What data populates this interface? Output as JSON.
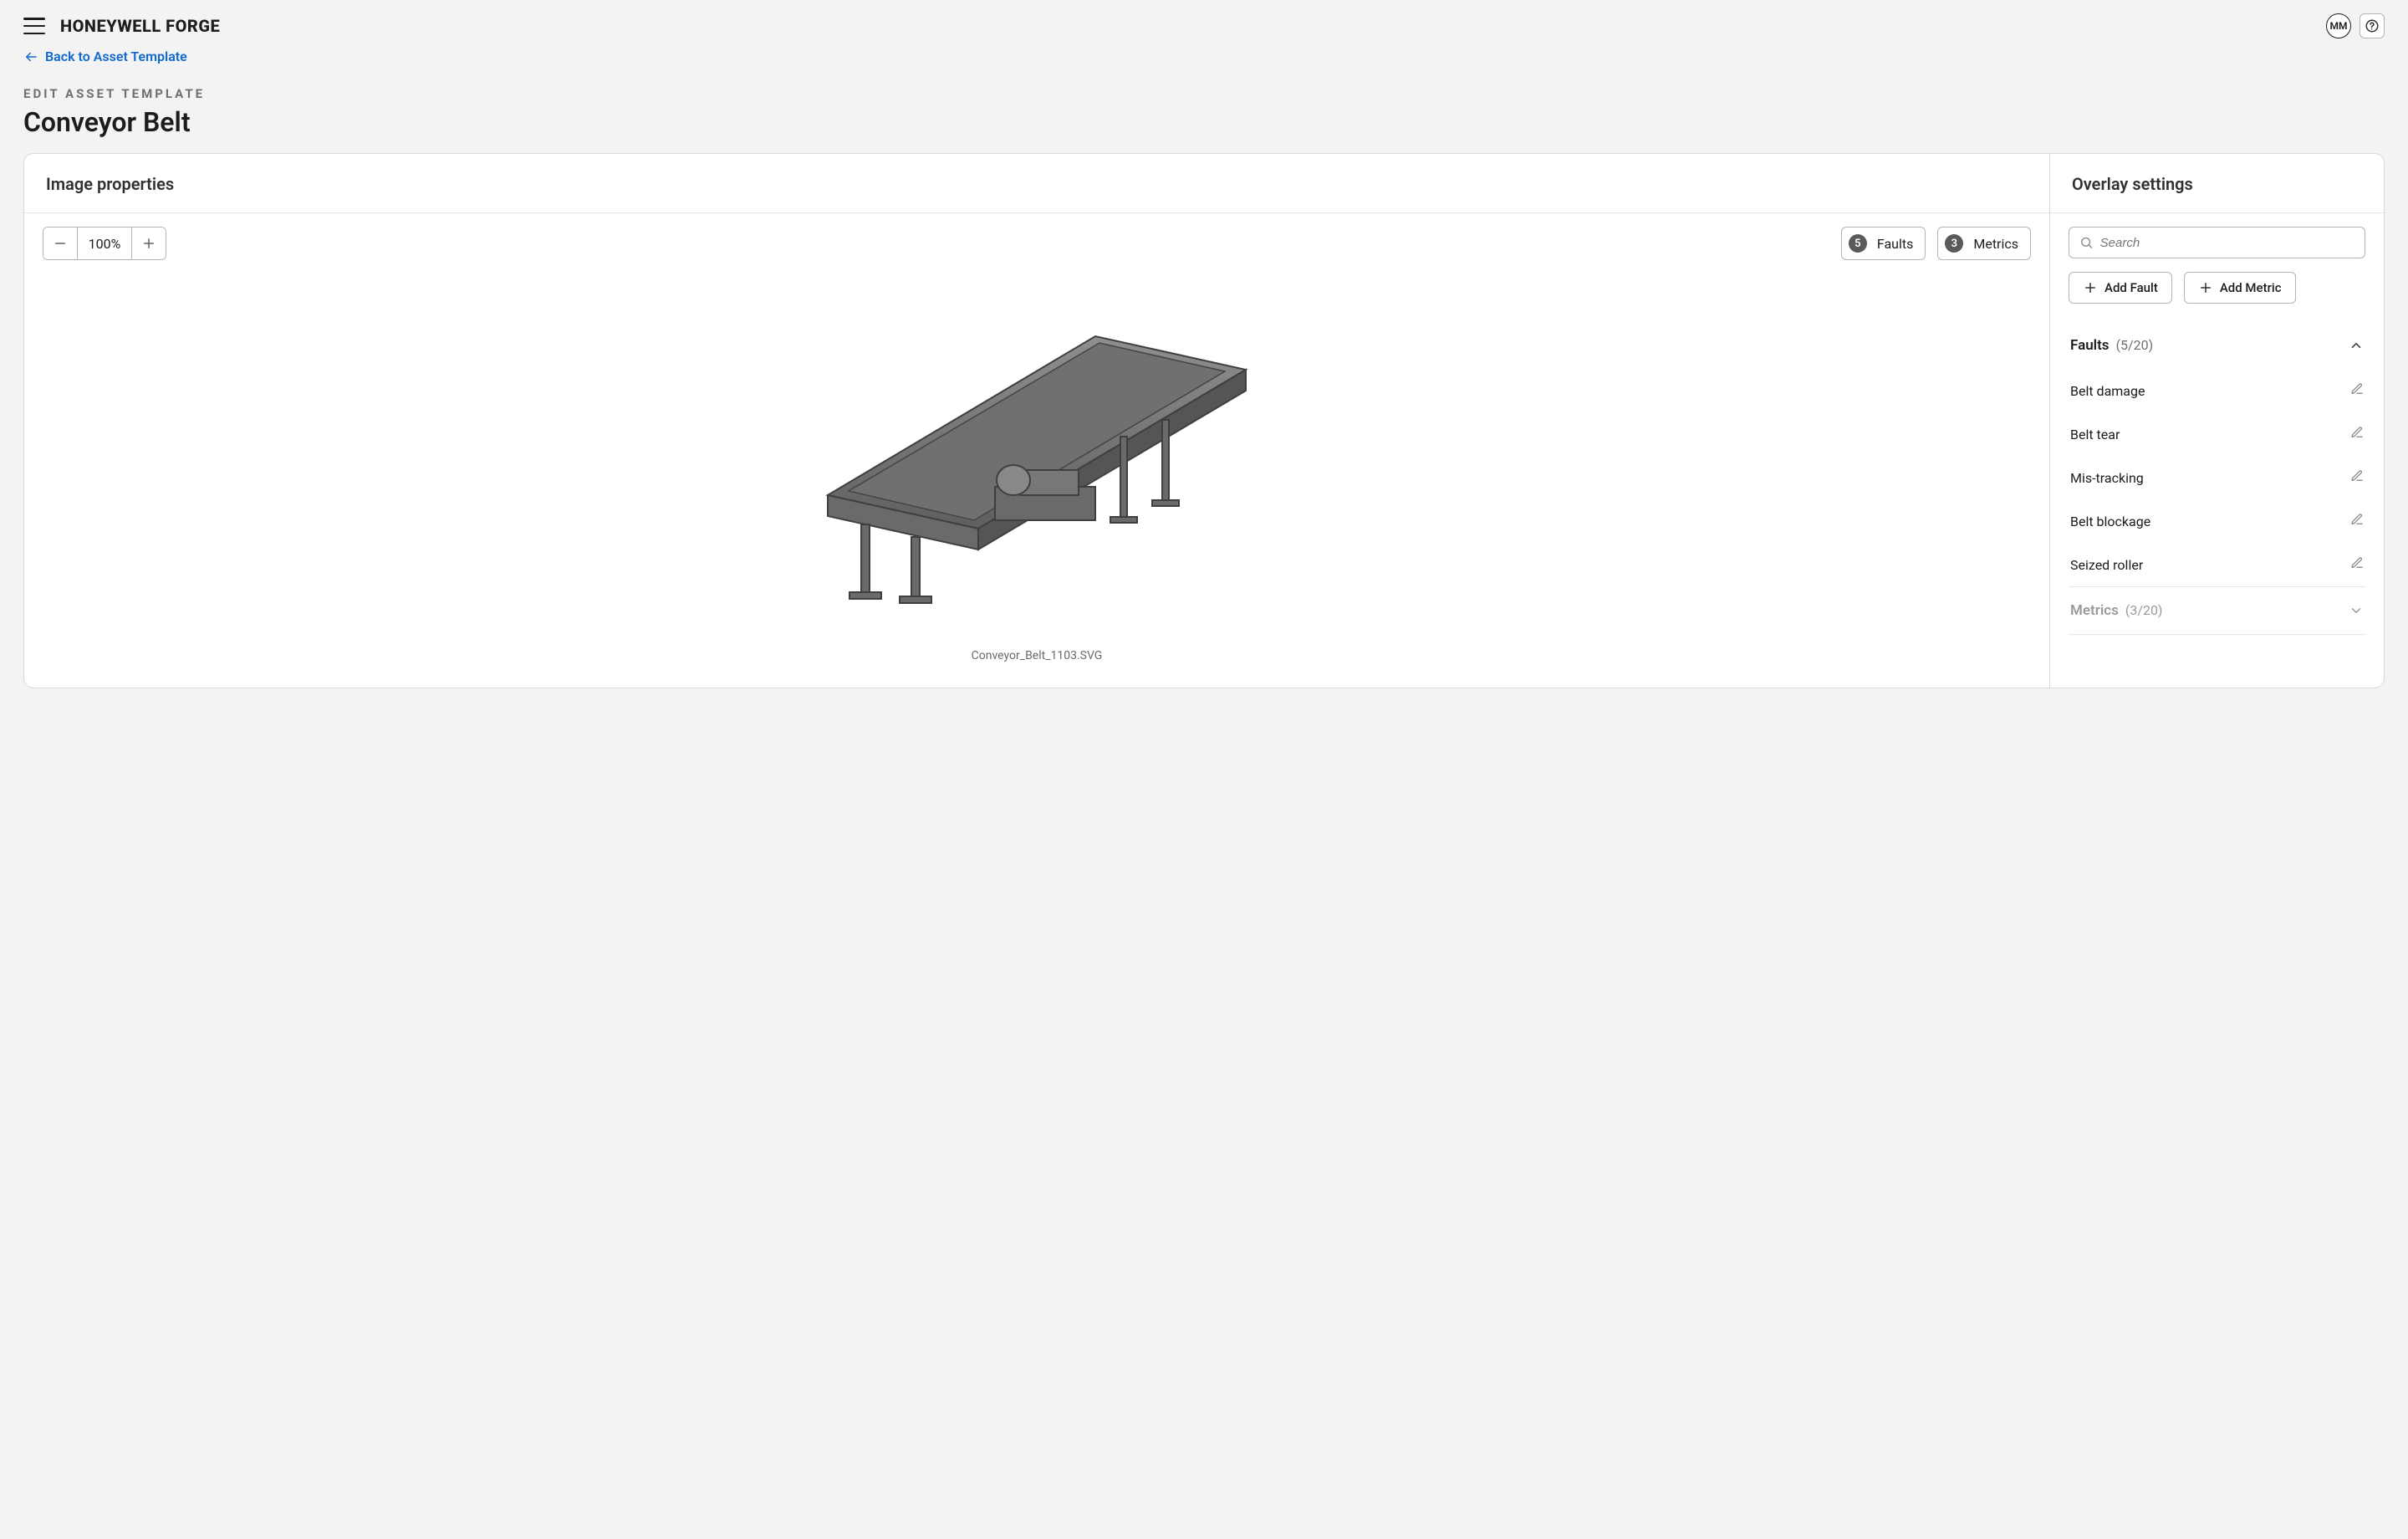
{
  "header": {
    "brand": "HONEYWELL FORGE",
    "avatar_initials": "MM"
  },
  "nav": {
    "back_label": "Back to Asset Template"
  },
  "page": {
    "eyebrow": "EDIT ASSET TEMPLATE",
    "title": "Conveyor Belt"
  },
  "image_panel": {
    "title": "Image properties",
    "zoom_value": "100%",
    "faults_badge": {
      "count": "5",
      "label": "Faults"
    },
    "metrics_badge": {
      "count": "3",
      "label": "Metrics"
    },
    "filename": "Conveyor_Belt_1103.SVG"
  },
  "overlay_panel": {
    "title": "Overlay settings",
    "search_placeholder": "Search",
    "add_fault_label": "Add Fault",
    "add_metric_label": "Add Metric",
    "faults_section": {
      "label": "Faults",
      "count": "(5/20)"
    },
    "fault_items": [
      {
        "label": "Belt damage"
      },
      {
        "label": "Belt tear"
      },
      {
        "label": "Mis-tracking"
      },
      {
        "label": "Belt blockage"
      },
      {
        "label": "Seized roller"
      }
    ],
    "metrics_section": {
      "label": "Metrics",
      "count": "(3/20)"
    }
  }
}
